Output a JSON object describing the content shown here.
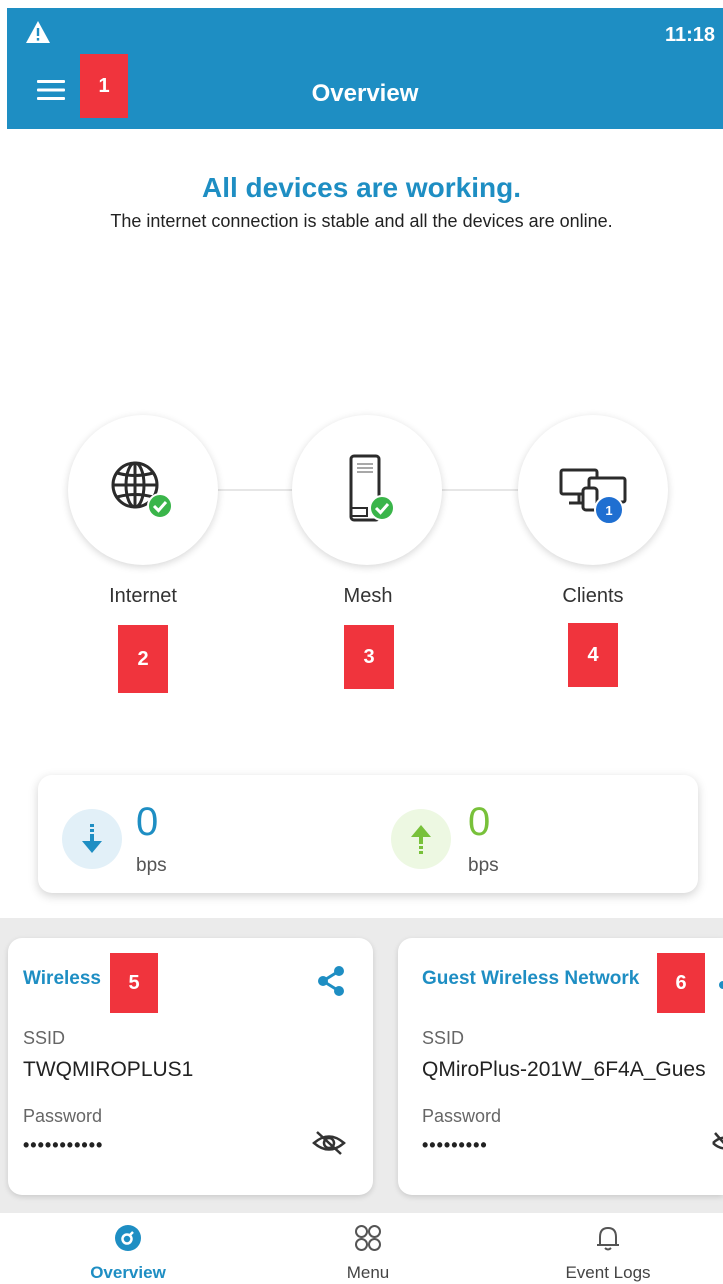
{
  "status_bar": {
    "time": "11:18",
    "warning_icon": "warning-icon"
  },
  "app_bar": {
    "title": "Overview",
    "menu_icon": "hamburger-menu-icon"
  },
  "markers": [
    "1",
    "2",
    "3",
    "4",
    "5",
    "6"
  ],
  "status": {
    "headline": "All devices are working.",
    "message": "The internet connection is stable and all the devices are online."
  },
  "topology": {
    "internet": {
      "label": "Internet",
      "icon": "globe-icon",
      "badge": "check-icon"
    },
    "mesh": {
      "label": "Mesh",
      "icon": "router-icon",
      "badge": "check-icon"
    },
    "clients": {
      "label": "Clients",
      "icon": "devices-icon",
      "count": "1"
    }
  },
  "throughput": {
    "download": {
      "value": "0",
      "unit": "bps",
      "icon": "download-arrow-icon"
    },
    "upload": {
      "value": "0",
      "unit": "bps",
      "icon": "upload-arrow-icon"
    }
  },
  "wireless": {
    "title": "Wireless",
    "ssid_label": "SSID",
    "ssid": "TWQMIROPLUS1",
    "password_label": "Password",
    "password_masked": "•••••••••••",
    "share_icon": "share-icon",
    "visibility_icon": "eye-off-icon"
  },
  "guest": {
    "title": "Guest Wireless Network",
    "ssid_label": "SSID",
    "ssid": "QMiroPlus-201W_6F4A_Gues",
    "password_label": "Password",
    "password_masked": "•••••••••"
  },
  "bottom_nav": [
    {
      "label": "Overview",
      "icon": "overview-icon",
      "active": true
    },
    {
      "label": "Menu",
      "icon": "grid-icon",
      "active": false
    },
    {
      "label": "Event Logs",
      "icon": "bell-icon",
      "active": false
    }
  ],
  "colors": {
    "brand": "#1e8ec3",
    "success": "#3ab54a",
    "upload": "#78c13a",
    "marker": "#f0343d",
    "client_badge": "#1f6fd1"
  }
}
